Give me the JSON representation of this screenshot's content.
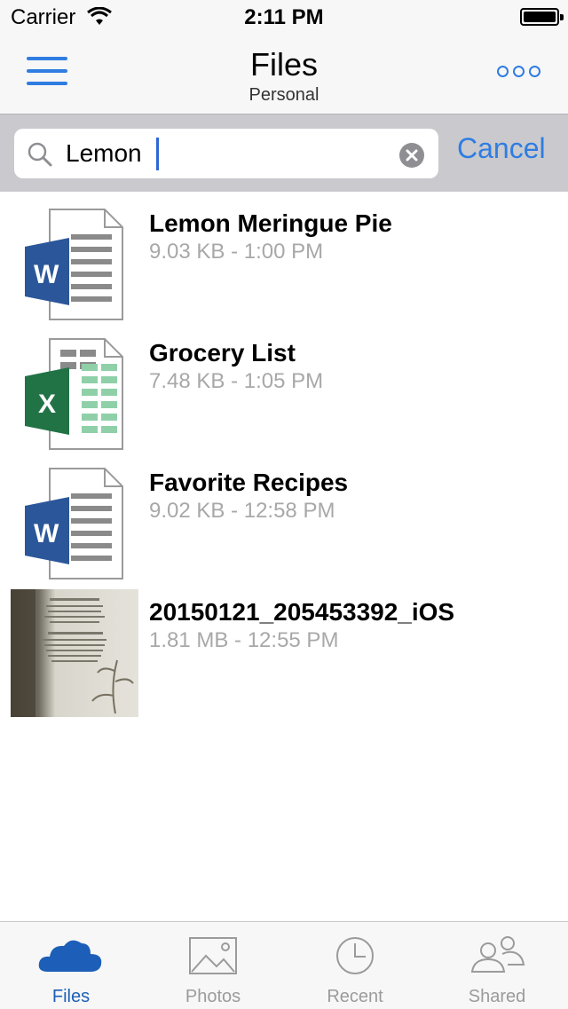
{
  "status_bar": {
    "carrier": "Carrier",
    "time": "2:11 PM"
  },
  "nav": {
    "title": "Files",
    "subtitle": "Personal"
  },
  "search": {
    "value": "Lemon",
    "cancel_label": "Cancel"
  },
  "files": [
    {
      "name": "Lemon Meringue Pie",
      "meta": "9.03 KB - 1:00 PM",
      "icon": "word-doc-icon"
    },
    {
      "name": "Grocery List",
      "meta": "7.48 KB - 1:05 PM",
      "icon": "excel-doc-icon"
    },
    {
      "name": "Favorite Recipes",
      "meta": "9.02 KB - 12:58 PM",
      "icon": "word-doc-icon"
    },
    {
      "name": "20150121_205453392_iOS",
      "meta": "1.81 MB - 12:55 PM",
      "icon": "photo-thumbnail"
    }
  ],
  "tabs": [
    {
      "label": "Files",
      "icon": "cloud-icon",
      "active": true
    },
    {
      "label": "Photos",
      "icon": "photo-icon",
      "active": false
    },
    {
      "label": "Recent",
      "icon": "clock-icon",
      "active": false
    },
    {
      "label": "Shared",
      "icon": "people-icon",
      "active": false
    }
  ],
  "colors": {
    "accent": "#2f7de1",
    "active_tab": "#1d5fb8",
    "word": "#2b579a",
    "excel": "#217346"
  }
}
